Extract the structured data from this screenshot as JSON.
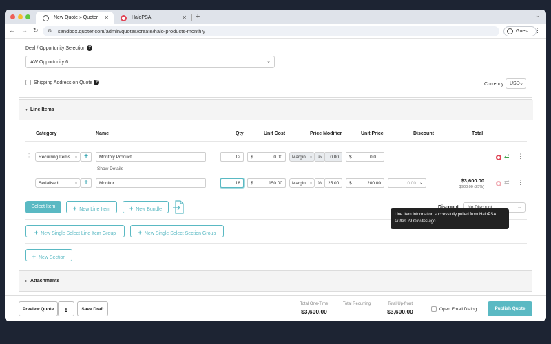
{
  "browser": {
    "tabs": [
      {
        "title": "New Quote » Quoter",
        "active": true
      },
      {
        "title": "HaloPSA",
        "active": false
      }
    ],
    "url": "sandbox.quoter.com/admin/quotes/create/halo-products-monthly",
    "guest_label": "Guest"
  },
  "form": {
    "deal_label": "Deal / Opportunity Selection",
    "deal_value": "AW Opportunity 6",
    "shipping_label": "Shipping Address on Quote",
    "currency_label": "Currency",
    "currency_value": "USD"
  },
  "line_items": {
    "title": "Line Items",
    "columns": [
      "Category",
      "Name",
      "Qty",
      "Unit Cost",
      "Price Modifier",
      "Unit Price",
      "Discount",
      "Total"
    ],
    "rows": [
      {
        "category": "Recurring Items",
        "name": "Monthly Product",
        "qty": "12",
        "unit_cost": "0.00",
        "modifier_type": "Margin",
        "modifier_unit": "%",
        "modifier_value": "0.00",
        "unit_price": "0.0",
        "show_details": "Show Details"
      },
      {
        "category": "Serialised",
        "name": "Monitor",
        "qty": "18",
        "unit_cost": "150.00",
        "modifier_type": "Margin",
        "modifier_unit": "%",
        "modifier_value": "25.00",
        "unit_price": "200.00",
        "discount": "0.00",
        "total": "$3,600.00",
        "total_sub": "$900.00 (25%)"
      }
    ],
    "currency_symbol": "$",
    "tooltip_line1": "Line Item information successfully pulled from HaloPSA.",
    "tooltip_line2": "Pulled 29 minutes ago.",
    "select_item": "Select Item",
    "new_line_item": "New Line Item",
    "new_bundle": "New Bundle",
    "discount_label": "Discount",
    "discount_value": "No Discount",
    "new_single_line_group": "New Single Select Line Item Group",
    "new_single_section_group": "New Single Select Section Group",
    "new_section": "New Section"
  },
  "attachments": {
    "title": "Attachments"
  },
  "footer": {
    "preview": "Preview Quote",
    "save_draft": "Save Draft",
    "total_one_time_label": "Total One-Time",
    "total_one_time": "$3,600.00",
    "total_recurring_label": "Total Recurring",
    "total_recurring": "—",
    "total_upfront_label": "Total Up-front",
    "total_upfront": "$3,600.00",
    "email_label": "Open Email Dialog",
    "publish": "Publish Quote"
  },
  "colors": {
    "accent": "#5ab9c3",
    "halo": "#e04354",
    "sync": "#3fa34d"
  }
}
